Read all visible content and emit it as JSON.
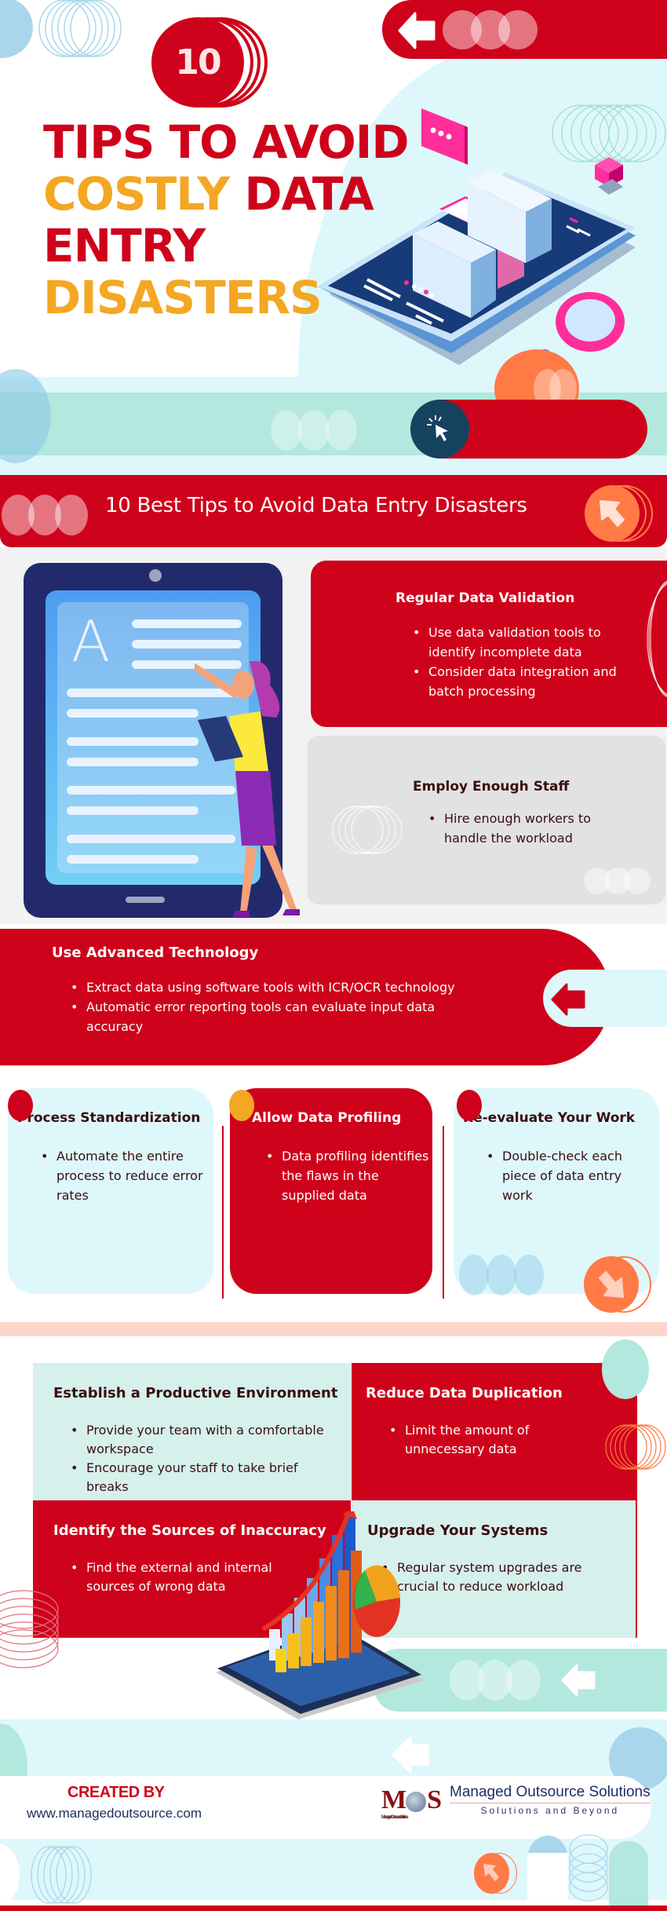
{
  "hero": {
    "badge_number": "10",
    "title_lines": [
      {
        "text": "TIPS TO AVOID",
        "color": "red"
      },
      {
        "text": "COSTLY",
        "color": "orange",
        "text2": " DATA",
        "color2": "red"
      },
      {
        "text": "ENTRY",
        "color": "red"
      },
      {
        "text": "DISASTERS",
        "color": "orange"
      }
    ],
    "icons": [
      "arrow-left-icon",
      "cursor-click-icon",
      "magnifier-icon",
      "chat-bubble-icon",
      "phone-illustration"
    ]
  },
  "tips_header": {
    "title": "10 Best Tips to Avoid Data Entry Disasters"
  },
  "tips": {
    "validation": {
      "title": "Regular Data Validation",
      "bullets": [
        "Use data validation tools to identify incomplete data",
        "Consider data integration and batch processing"
      ]
    },
    "staff": {
      "title": "Employ Enough Staff",
      "bullets": [
        "Hire enough workers to handle the workload"
      ]
    },
    "technology": {
      "title": "Use Advanced Technology",
      "bullets": [
        "Extract data using software tools with ICR/OCR technology",
        "Automatic error reporting tools can evaluate input data accuracy"
      ]
    },
    "standardization": {
      "title": "Process Standardization",
      "bullets": [
        "Automate the entire process to reduce error rates"
      ]
    },
    "profiling": {
      "title": "Allow Data Profiling",
      "bullets": [
        "Data profiling identifies the flaws in the supplied data"
      ]
    },
    "reevaluate": {
      "title": "Re-evaluate Your Work",
      "bullets": [
        "Double-check each piece of data entry work"
      ]
    },
    "environment": {
      "title": "Establish a Productive Environment",
      "bullets": [
        "Provide your team with a comfortable workspace",
        "Encourage your staff to take brief breaks"
      ]
    },
    "duplication": {
      "title": "Reduce Data Duplication",
      "bullets": [
        "Limit the amount of unnecessary data"
      ]
    },
    "inaccuracy": {
      "title": "Identify the Sources of Inaccuracy",
      "bullets": [
        "Find the external and internal sources of wrong data"
      ]
    },
    "upgrade": {
      "title": "Upgrade Your Systems",
      "bullets": [
        "Regular system upgrades are crucial to reduce workload"
      ]
    }
  },
  "footer": {
    "created_by": "CREATED BY",
    "website": "www.managedoutsource.com",
    "logo_letters_left": "M",
    "logo_letters_right": "S",
    "logo_sub": "Managed Outsource Solutions",
    "company_name": "Managed Outsource Solutions",
    "tagline": "Solutions and Beyond"
  },
  "colors": {
    "red": "#cf021b",
    "orange": "#f4a723",
    "coral": "#ff7a45",
    "mint": "#b2e8dd",
    "light_blue": "#def7fb",
    "navy": "#15425f",
    "grey_card": "#e2e2e2",
    "dark_text": "#3a0d10"
  }
}
